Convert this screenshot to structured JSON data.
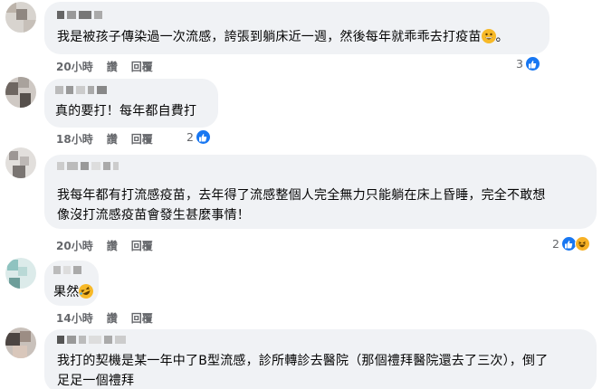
{
  "colors": {
    "bubble": "#f0f2f5",
    "meta_text": "#65676b",
    "like_blue": "#1877f2",
    "haha_yellow": "#f7b125"
  },
  "actions": {
    "like": "讚",
    "reply": "回覆"
  },
  "comments": [
    {
      "text_lines": [
        "我是被孩子傳染過一次流感，誇張到躺床近一週，然後每年就乖乖去打疫苗"
      ],
      "trailing_emoji": "grinning-sweat-emoji",
      "after_emoji": "。",
      "time": "20小時",
      "reaction_count": "3",
      "reaction_icons": [
        "like-icon"
      ]
    },
    {
      "text_lines": [
        "真的要打！每年都自費打"
      ],
      "time": "18小時",
      "reaction_count": "2",
      "reaction_icons": [
        "like-icon"
      ]
    },
    {
      "text_lines": [
        "我每年都有打流感疫苗，去年得了流感整個人完全無力只能躺在床上昏睡，完全不敢想",
        "像沒打流感疫苗會發生甚麼事情！"
      ],
      "time": "20小時",
      "reaction_count": "2",
      "reaction_icons": [
        "like-icon",
        "haha-icon"
      ]
    },
    {
      "text_lines": [
        "果然"
      ],
      "trailing_emoji": "rofl-emoji",
      "time": "14小時"
    },
    {
      "text_lines": [
        "我打的契機是某一年中了B型流感，診所轉診去醫院（那個禮拜醫院還去了三次），倒了",
        "足足一個禮拜"
      ]
    }
  ]
}
